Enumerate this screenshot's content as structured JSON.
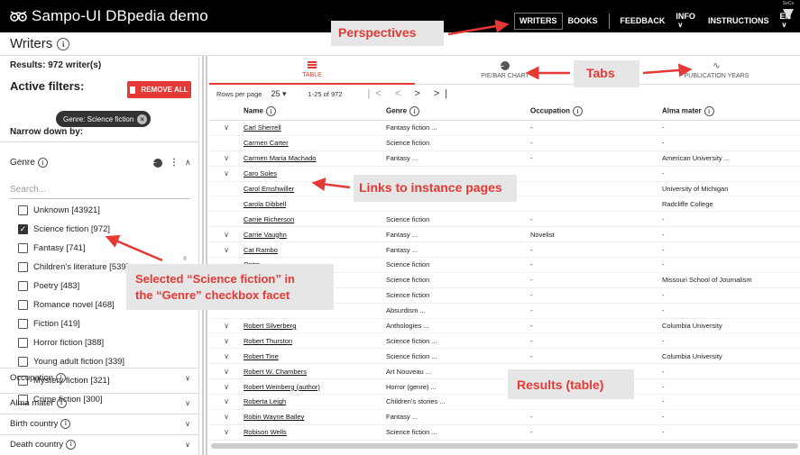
{
  "app": {
    "title": "Sampo-UI DBpedia demo",
    "nav": {
      "writers": "WRITERS",
      "books": "BOOKS",
      "feedback": "FEEDBACK",
      "info": "INFO",
      "instructions": "INSTRUCTIONS",
      "lang": "EN"
    },
    "logo_text": "SeCo"
  },
  "page": {
    "title": "Writers"
  },
  "left": {
    "results": "Results: 972 writer(s)",
    "active_filters": "Active filters:",
    "remove_all": "REMOVE ALL",
    "chip": "Genre: Science fiction",
    "narrow": "Narrow down by:",
    "genre_label": "Genre",
    "search_placeholder": "Search...",
    "genre_items": [
      {
        "label": "Unknown [43921]",
        "checked": false
      },
      {
        "label": "Science fiction [972]",
        "checked": true
      },
      {
        "label": "Fantasy [741]",
        "checked": false
      },
      {
        "label": "Children's literature [539]",
        "checked": false
      },
      {
        "label": "Poetry [483]",
        "checked": false
      },
      {
        "label": "Romance novel [468]",
        "checked": false
      },
      {
        "label": "Fiction [419]",
        "checked": false
      },
      {
        "label": "Horror fiction [388]",
        "checked": false
      },
      {
        "label": "Young adult fiction [339]",
        "checked": false
      },
      {
        "label": "Mystery fiction [321]",
        "checked": false
      },
      {
        "label": "Crime fiction [300]",
        "checked": false
      }
    ],
    "facets": [
      "Occupation",
      "Alma mater",
      "Birth country",
      "Death country"
    ]
  },
  "tabs": [
    {
      "label": "TABLE",
      "icon": "table-icon",
      "active": true
    },
    {
      "label": "PIE/BAR CHART",
      "icon": "pie-chart-icon",
      "active": false
    },
    {
      "label": "PUBLICATION YEARS",
      "icon": "line-chart-icon",
      "active": false
    }
  ],
  "pager": {
    "rows_per_page": "Rows per page",
    "rows_value": "25",
    "range": "1-25 of 972"
  },
  "table": {
    "headers": [
      "Name",
      "Genre",
      "Occupation",
      "Alma mater"
    ],
    "rows": [
      {
        "expand": true,
        "name": "Carl Sherrell",
        "genre": "Fantasy fiction ...",
        "occupation": "-",
        "alma": "-"
      },
      {
        "expand": false,
        "name": "Carmen Carter",
        "genre": "Science fiction",
        "occupation": "-",
        "alma": "-"
      },
      {
        "expand": true,
        "name": "Carmen Maria Machado",
        "genre": "Fantasy ...",
        "occupation": "-",
        "alma": "American University ..."
      },
      {
        "expand": true,
        "name": "Caro Soles",
        "genre": "",
        "occupation": "",
        "alma": "-"
      },
      {
        "expand": false,
        "name": "Carol Emshwiller",
        "genre": "",
        "occupation": "",
        "alma": "University of Michigan"
      },
      {
        "expand": false,
        "name": "Carola Dibbell",
        "genre": "",
        "occupation": "",
        "alma": "Radcliffe College"
      },
      {
        "expand": false,
        "name": "Carrie Richerson",
        "genre": "Science fiction",
        "occupation": "-",
        "alma": "-"
      },
      {
        "expand": true,
        "name": "Carrie Vaughn",
        "genre": "Fantasy ...",
        "occupation": "Novelist",
        "alma": "-"
      },
      {
        "expand": true,
        "name": "Cat Rambo",
        "genre": "Fantasy ...",
        "occupation": "-",
        "alma": "-"
      },
      {
        "expand": false,
        "name": "Qntm",
        "genre": "Science fiction",
        "occupation": "-",
        "alma": "-"
      },
      {
        "expand": false,
        "name": "",
        "genre": "Science fiction",
        "occupation": "-",
        "alma": "Missouri School of Journalism"
      },
      {
        "expand": false,
        "name": "",
        "genre": "Science fiction",
        "occupation": "-",
        "alma": "-"
      },
      {
        "expand": false,
        "name": "",
        "genre": "Absurdism ...",
        "occupation": "-",
        "alma": "-"
      },
      {
        "expand": true,
        "name": "Robert Silverberg",
        "genre": "Anthologies ...",
        "occupation": "-",
        "alma": "Columbia University"
      },
      {
        "expand": true,
        "name": "Robert Thurston",
        "genre": "Science fiction ...",
        "occupation": "-",
        "alma": "-"
      },
      {
        "expand": true,
        "name": "Robert Tine",
        "genre": "Science fiction ...",
        "occupation": "-",
        "alma": "Columbia University"
      },
      {
        "expand": true,
        "name": "Robert W. Chambers",
        "genre": "Art Nouveau ...",
        "occupation": "-",
        "alma": "-"
      },
      {
        "expand": true,
        "name": "Robert Weinberg (author)",
        "genre": "Horror (genre) ...",
        "occupation": "",
        "alma": "-"
      },
      {
        "expand": true,
        "name": "Roberta Leigh",
        "genre": "Children's stories ...",
        "occupation": "",
        "alma": "-"
      },
      {
        "expand": true,
        "name": "Robin Wayne Bailey",
        "genre": "Fantasy ...",
        "occupation": "-",
        "alma": "-"
      },
      {
        "expand": true,
        "name": "Robison Wells",
        "genre": "Science fiction ...",
        "occupation": "-",
        "alma": "-"
      }
    ]
  },
  "annotations": {
    "perspectives": "Perspectives",
    "tabs": "Tabs",
    "links": "Links to instance pages",
    "selected_line1": "Selected “Science fiction” in",
    "selected_line2": "the “Genre” checkbox facet",
    "results": "Results (table)"
  },
  "colors": {
    "accent": "#e53935",
    "appbar": "#000000",
    "callout_bg": "#e6e6e6"
  }
}
